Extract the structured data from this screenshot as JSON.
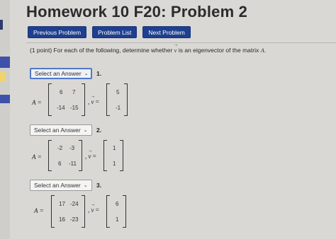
{
  "title": "Homework 10 F20: Problem 2",
  "nav": {
    "previous": "Previous Problem",
    "list": "Problem List",
    "next": "Next Problem"
  },
  "instruction": {
    "prefix": "(1 point) For each of the following, determine whether",
    "vector_symbol": "v",
    "middle": "is an eigenvector of the matrix",
    "matrix_symbol": "A",
    "suffix": "."
  },
  "select_placeholder": "Select an Answer",
  "problems": [
    {
      "number": "1.",
      "A": [
        [
          "6",
          "7"
        ],
        [
          "-14",
          "-15"
        ]
      ],
      "v": [
        "5",
        "-1"
      ]
    },
    {
      "number": "2.",
      "A": [
        [
          "-2",
          "-3"
        ],
        [
          "6",
          "-11"
        ]
      ],
      "v": [
        "1",
        "1"
      ]
    },
    {
      "number": "3.",
      "A": [
        [
          "17",
          "-24"
        ],
        [
          "16",
          "-23"
        ]
      ],
      "v": [
        "6",
        "1"
      ]
    }
  ],
  "labels": {
    "A_eq": "A =",
    "comma": ",",
    "v_eq": "="
  },
  "colors": {
    "nav_button": "#1f3f8f",
    "focus_border": "#4f78c8",
    "background": "#d9d8d4"
  }
}
